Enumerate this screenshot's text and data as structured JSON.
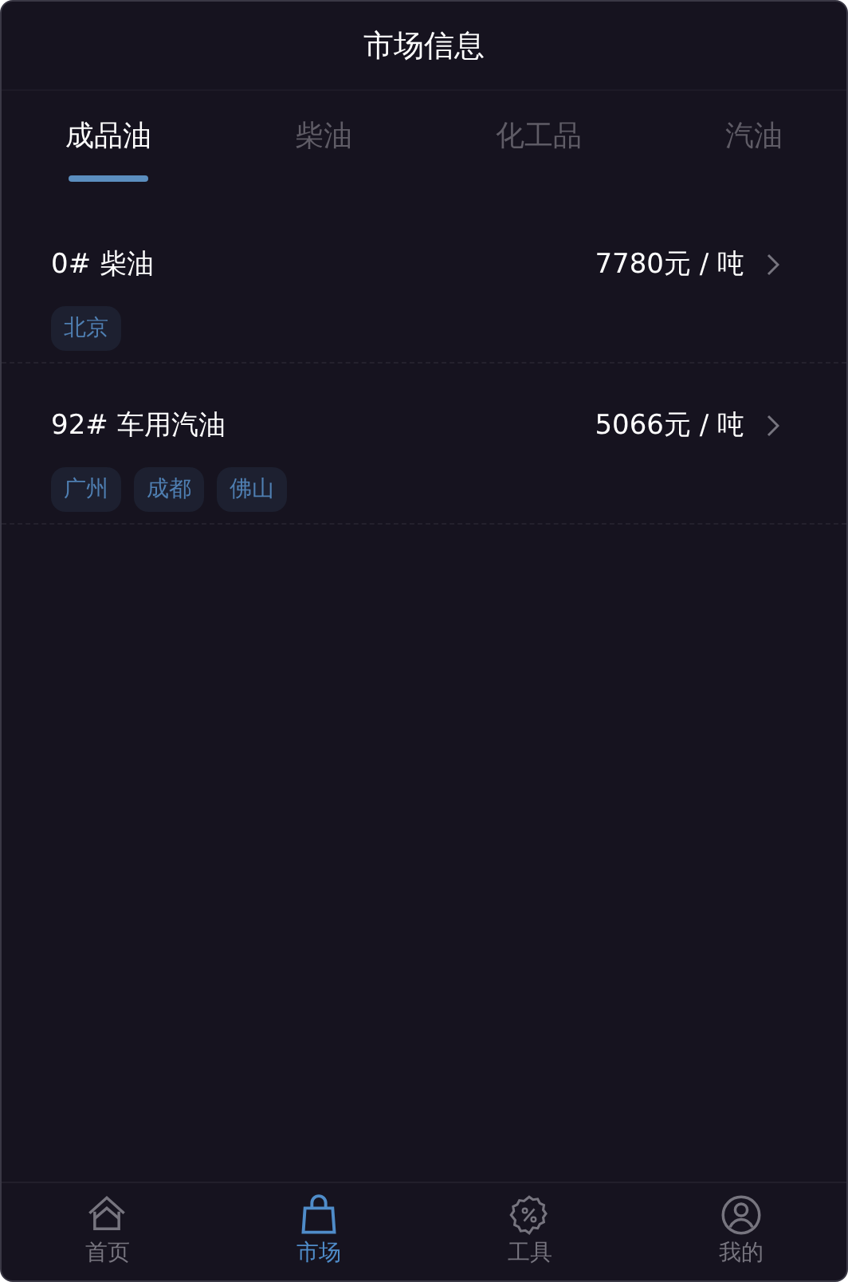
{
  "header": {
    "title": "市场信息"
  },
  "tabs": [
    {
      "label": "成品油",
      "selected": true
    },
    {
      "label": "柴油",
      "selected": false
    },
    {
      "label": "化工品",
      "selected": false
    },
    {
      "label": "汽油",
      "selected": false
    }
  ],
  "items": [
    {
      "name": "0# 柴油",
      "price": "7780元 / 吨",
      "tags": [
        "北京"
      ]
    },
    {
      "name": "92# 车用汽油",
      "price": "5066元 / 吨",
      "tags": [
        "广州",
        "成都",
        "佛山"
      ]
    }
  ],
  "nav": [
    {
      "kind": "home",
      "label": "首页",
      "selected": false
    },
    {
      "kind": "market",
      "label": "市场",
      "selected": true
    },
    {
      "kind": "tools",
      "label": "工具",
      "selected": false
    },
    {
      "kind": "profile",
      "label": "我的",
      "selected": false
    }
  ]
}
